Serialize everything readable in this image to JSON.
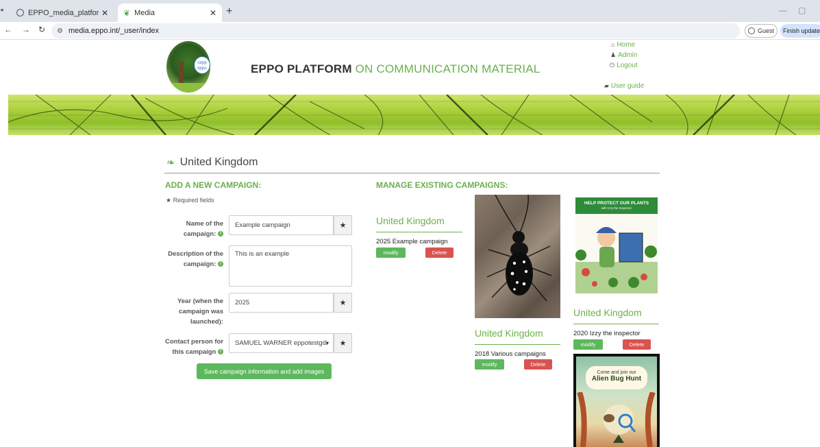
{
  "browser": {
    "tabs": [
      {
        "title": "EPPO_media_platform_user-gu",
        "active": false
      },
      {
        "title": "Media",
        "active": true
      }
    ],
    "url": "media.eppo.int/_user/index",
    "guest_label": "Guest",
    "finish_update_label": "Finish update"
  },
  "site": {
    "logo_text_1": "oepp",
    "logo_text_2": "eppo",
    "title_dark": "EPPO PLATFORM",
    "title_green": "ON COMMUNICATION MATERIAL",
    "nav": {
      "home": "Home",
      "admin": "Admin",
      "logout": "Logout",
      "user_guide": "User guide"
    }
  },
  "page": {
    "country": "United Kingdom",
    "add_title": "ADD A NEW CAMPAIGN:",
    "manage_title": "MANAGE EXISTING CAMPAIGNS:",
    "required_note": "Required fields",
    "form": {
      "name_label_1": "Name of the",
      "name_label_2": "campaign:",
      "name_value": "Example campaign",
      "desc_label_1": "Description of the",
      "desc_label_2": "campaign:",
      "desc_value": "This is an example",
      "year_label_1": "Year (when the",
      "year_label_2": "campaign was",
      "year_label_3": "launched):",
      "year_value": "2025",
      "contact_label_1": "Contact person for",
      "contact_label_2": "this campaign",
      "contact_value": "SAMUEL WARNER eppotestgdi",
      "save_label": "Save campaign information and add images"
    },
    "campaigns": [
      {
        "country": "United Kingdom",
        "title": "2025 Example campaign",
        "modify": "modify",
        "delete": "Delete"
      },
      {
        "country": "United Kingdom",
        "title": "2018 Various campaigns",
        "modify": "modify",
        "delete": "Delete"
      },
      {
        "country": "United Kingdom",
        "title": "2020 Izzy the inspector",
        "modify": "modify",
        "delete": "Delete"
      }
    ],
    "posters": {
      "izzy_head": "HELP PROTECT OUR PLANTS",
      "izzy_sub": "with Izzy the Inspector",
      "bughunt_line1": "Come and join our",
      "bughunt_line2": "Alien Bug Hunt"
    }
  },
  "colors": {
    "accent_green": "#6ab04c",
    "button_green": "#5cb85c",
    "button_red": "#d9534f"
  }
}
